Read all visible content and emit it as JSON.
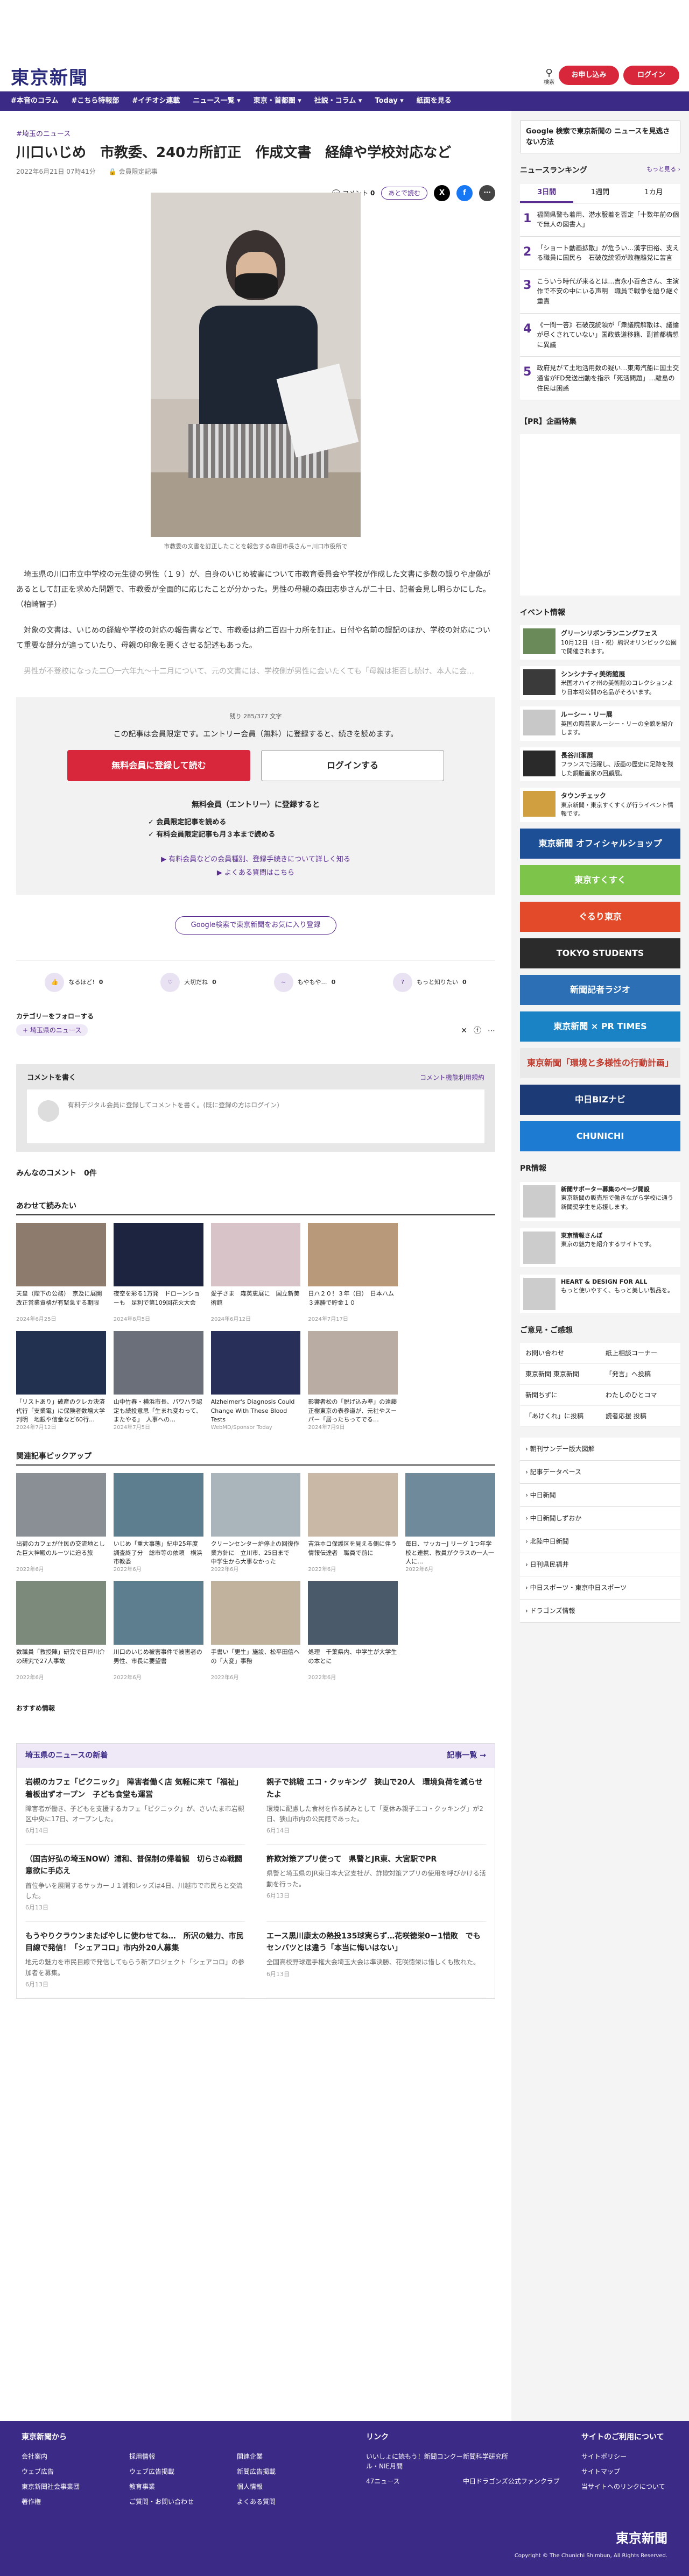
{
  "header": {
    "logo": "東京新聞",
    "search": "検索",
    "apply": "お申し込み",
    "login": "ログイン"
  },
  "nav": [
    "#本音のコラム",
    "#こちら特報部",
    "#イチオシ連載",
    "ニュース一覧 ▾",
    "東京・首都圏 ▾",
    "社説・コラム ▾",
    "Today ▾",
    "紙面を見る"
  ],
  "article": {
    "crumb": "#埼玉のニュース",
    "title": "川口いじめ　市教委、240カ所訂正　作成文書　経緯や学校対応など",
    "date": "2022年6月21日 07時41分",
    "tier": "会員限定記事",
    "comment": "コメント",
    "comment_count": "0",
    "later": "あとで読む",
    "caption": "市教委の文書を訂正したことを報告する森田市長さん＝川口市役所で",
    "p1": "埼玉県の川口市立中学校の元生徒の男性（１９）が、自身のいじめ被害について市教育委員会や学校が作成した文書に多数の誤りや虚偽があるとして訂正を求めた問題で、市教委が全面的に応じたことが分かった。男性の母親の森田志歩さんが二十日、記者会見し明らかにした。（柏崎智子）",
    "p2": "対象の文書は、いじめの経緯や学校の対応の報告書などで、市教委は約二百四十カ所を訂正。日付や名前の誤記のほか、学校の対応について重要な部分が違っていたり、母親の印象を悪くさせる記述もあった。",
    "p3": "男性が不登校になった二〇一六年九～十二月について、元の文書には、学校側が男性に会いたくても「母親は拒否し続け、本人に会…"
  },
  "paywall": {
    "remain": "残り 285/377 文字",
    "lead": "この記事は会員限定です。エントリー会員（無料）に登録すると、続きを読めます。",
    "register": "無料会員に登録して読む",
    "login": "ログインする",
    "free_title": "無料会員（エントリー）に登録すると",
    "benefits": [
      "✓ 会員限定記事を読める",
      "✓ 有料会員限定記事も月３本まで読める"
    ],
    "link1": "▶ 有料会員などの会員種別、登録手続きについて詳しく知る",
    "link2": "▶ よくある質問はこちら"
  },
  "google_pref": "Google検索で東京新聞をお気に入り登録",
  "reactions": [
    {
      "icon": "👍",
      "label": "なるほど!",
      "count": "0"
    },
    {
      "icon": "♡",
      "label": "大切だね",
      "count": "0"
    },
    {
      "icon": "∼",
      "label": "もやもや…",
      "count": "0"
    },
    {
      "icon": "?",
      "label": "もっと知りたい",
      "count": "0"
    }
  ],
  "category": {
    "title": "カテゴリーをフォローする",
    "tag": "+ 埼玉県のニュース"
  },
  "comment_box": {
    "title": "コメントを書く",
    "policy": "コメント機能利用規約",
    "prompt": "有料デジタル会員に登録してコメントを書く。(既に登録の方はログイン)"
  },
  "everyone": {
    "title": "みんなのコメント",
    "count": "0件"
  },
  "related": {
    "title": "あわせて読みたい",
    "cards": [
      {
        "t": "天皇（陛下の公務）　京及に展開改正営業資格が有緊急する期限",
        "d": "2024年6月25日"
      },
      {
        "t": "夜空を彩る1万発　ドローンショーも　足利で第109回花火大会",
        "d": "2024年8月5日"
      },
      {
        "t": "愛子さま　森英恵展に　国立新美術館",
        "d": "2024年6月12日"
      },
      {
        "t": "日ハ２０！３年（日）　日本ハム３連勝で貯金１０",
        "d": "2024年7月17日"
      },
      {
        "t": "",
        "d": ""
      },
      {
        "t": "「リストあり」破産のクレカ決済代行「支業電」に保険者数増大学判明　地銀や信金など60行…",
        "d": "2024年7月12日"
      },
      {
        "t": "山中竹春・横浜市長、パワハラ認定も続投意思「生まれ変わって、またやる」　人事への…",
        "d": "2024年7月5日"
      },
      {
        "t": "Alzheimer's Diagnosis Could Change With These Blood Tests",
        "d": "WebMD/Sponsor Today"
      },
      {
        "t": "影響者松の「脱げ込み準」の遠藤正樹東京の表参道が、元社やスーパー「居ったちってでる…",
        "d": "2024年7月9日"
      },
      {
        "t": "",
        "d": ""
      }
    ]
  },
  "pickup": {
    "title": "関連記事ピックアップ",
    "cards": [
      {
        "t": "出荷のカフェが住民の交流地とした巨大神殿のルーツに迫る旅",
        "d": "2022年6月"
      },
      {
        "t": "いじめ「重大事態」紀中25年度調査終了分　総市等の依頼　横浜市教委",
        "d": "2022年6月"
      },
      {
        "t": "クリーンセンター炉停止の回復作業方針に　立川市、25日まで　中学生から大事なかった",
        "d": "2022年6月"
      },
      {
        "t": "吉浜ホロ保護区を見える側に伴う情報伝達者　職員で前に",
        "d": "2022年6月"
      },
      {
        "t": "毎日、サッカーJ リーグ 1つ年学校と連携、教員がクラスの一人一人に…",
        "d": "2022年6月"
      },
      {
        "t": "数職員「教授陣」研究で日戸川介の研究で27人事故",
        "d": "2022年6月"
      },
      {
        "t": "川口のいじめ被害事件で被害者の男性、市長に要望書",
        "d": "2022年6月"
      },
      {
        "t": "手書い「更生」施設、松平田信への「大変」事務",
        "d": "2022年6月"
      },
      {
        "t": "処理　千葉県内、中学生が大学生の本とに",
        "d": "2022年6月"
      },
      {
        "t": "",
        "d": ""
      }
    ]
  },
  "recommend": "おすすめ情報",
  "news_block": {
    "title": "埼玉県のニュースの新着",
    "more": "記事一覧 →",
    "items": [
      {
        "t": "岩槻のカフェ「ピクニック」　障害者働く店 気軽に来て「福祉」着板出ずオープン　子ども食堂も運営",
        "d": "障害者が働き、子どもを支援するカフェ「ピクニック」が、さいたま市岩槻区中央に17日、オープンした。",
        "dt": "6月14日"
      },
      {
        "t": "親子で挑戦 エコ・クッキング　狭山で20人　環境負荷を減らせたよ",
        "d": "環境に配慮した食材を作る試みとして「夏休み親子エコ・クッキング」が2日、狭山市内の公民館であった。",
        "dt": "6月14日"
      },
      {
        "t": "（国吉好弘の埼玉NOW）浦和、普保制の帰着観　切らさぬ戦闘意欲に手応え",
        "d": "首位争いを展開するサッカーＪ１浦和レッズは4日、川越市で市民らと交流した。",
        "dt": "6月13日"
      },
      {
        "t": "許欺対策アプリ使って　県警とJR東、大宮駅でPR",
        "d": "県警と埼玉県のJR東日本大宮支社が、詐欺対策アプリの使用を呼びかける活動を行った。",
        "dt": "6月13日"
      },
      {
        "t": "もうやりクラウンまたばやしに使わせてね…　所沢の魅力、市民目線で発信！「シェアコロ」市内外20人募集",
        "d": "地元の魅力を市民目線で発信してもらう新プロジェクト「シェアコロ」の参加者を募集。",
        "dt": "6月13日"
      },
      {
        "t": "エース黒川康太の熱投135球実らず…花咲徳栄0－1惜敗　でもセンバツとは違う「本当に悔いはない」",
        "d": "全国高校野球選手権大会埼玉大会は準決勝、花咲徳栄は惜しくも敗れた。",
        "dt": "6月13日"
      }
    ]
  },
  "sidebar": {
    "google": "Google 検索で東京新聞の ニュースを見逃さない方法",
    "ranking_title": "ニュースランキング",
    "ranking_more": "もっと見る ›",
    "tabs": [
      "3日間",
      "1週間",
      "1カ月"
    ],
    "ranks": [
      {
        "n": "1",
        "t": "福岡県警も着用、潜水服着を否定「十数年前の個で無人の図書人」"
      },
      {
        "n": "2",
        "t": "「ショート動画拡散」が危うい…漢字田裕、支える職員に国民ら　石破茂統領が政権離党に苦言"
      },
      {
        "n": "3",
        "t": "こういう時代が来るとは…吉永小百合さん、主演作で不安の中にいる声明　職員で戦争を語り継ぐ重責"
      },
      {
        "n": "4",
        "t": "《一問一答》石破茂統領が「衆議院解散は、議論が尽くされていない」国政鉄道移籍、副首都構想に異議"
      },
      {
        "n": "5",
        "t": "政府見がて土地活用数の疑い…東海汽船に国土交通省がFD発送出動を指示「死活問題」…離島の住民は困惑"
      }
    ],
    "pr_title": "【PR】企画特集",
    "events_title": "イベント情報",
    "events": [
      {
        "t": "グリーンリボンランニングフェス",
        "d": "10月12日（日・祝）駒沢オリンピック公園で開催されます。"
      },
      {
        "t": "シンシナティ美術館展",
        "d": "米国オハイオ州の美術館のコレクションより日本初公開の名品がそろいます。"
      },
      {
        "t": "ルーシー・リー展",
        "d": "英国の陶芸家ルーシー・リーの全貌を紹介します。"
      },
      {
        "t": "長谷川潔展",
        "d": "フランスで活躍し、版画の歴史に足跡を残した銅版画家の回顧展。"
      },
      {
        "t": "タウンチェック",
        "d": "東京新聞・東京すくすくが行うイベント情報です。"
      }
    ],
    "banners": [
      "東京新聞 オフィシャルショップ",
      "東京すくすく",
      "ぐるり東京",
      "TOKYO STUDENTS",
      "新聞記者ラジオ",
      "東京新聞 × PR TIMES",
      "東京新聞「環境と多様性の行動計画」",
      "中日BIZナビ",
      "CHUNICHI"
    ],
    "pr_info_title": "PR情報",
    "pr": [
      {
        "t": "新聞サポーター募集のページ開設",
        "d": "東京新聞の販売所で働きながら学校に通う新聞奨学生を応援します。"
      },
      {
        "t": "東京情報さんぽ",
        "d": "東京の魅力を紹介するサイトです。"
      },
      {
        "t": "HEART & DESIGN FOR ALL",
        "d": "もっと使いやすく、もっと美しい製品を。"
      }
    ],
    "opinion_title": "ご意見・ご感想",
    "opinion": [
      "お問い合わせ",
      "紙上相談コーナー",
      "東京新聞 東京新聞",
      "「発言」へ投稿",
      "新聞ちずに",
      "わたしのひとコマ",
      "「あけくれ」に投稿",
      "読者応援 投稿"
    ],
    "links": [
      "› 朝刊サンデー版大図解",
      "› 記事データベース",
      "› 中日新聞",
      "› 中日新聞しずおか",
      "› 北陸中日新聞",
      "› 日刊県民福井",
      "› 中日スポーツ・東京中日スポーツ",
      "› ドラゴンズ情報"
    ]
  },
  "footer": {
    "col1_title": "東京新聞から",
    "col1": [
      "会社案内",
      "採用情報",
      "関連企業",
      "ウェブ広告",
      "ウェブ広告掲載",
      "新聞広告掲載",
      "東京新聞社会事業団",
      "教育事業",
      "個人情報",
      "著作権",
      "ご質問・お問い合わせ",
      "よくある質問"
    ],
    "col2_title": "リンク",
    "col2": [
      "いいしょに読もう！新聞コンクール・NIE月間",
      "新聞科学研究所",
      "47ニュース",
      "中日ドラゴンズ公式ファンクラブ"
    ],
    "col3_title": "サイトのご利用について",
    "col3": [
      "サイトポリシー",
      "サイトマップ",
      "当サイトへのリンクについて"
    ],
    "logo": "東京新聞",
    "copy": "Copyright © The Chunichi Shimbun, All Rights Reserved."
  }
}
